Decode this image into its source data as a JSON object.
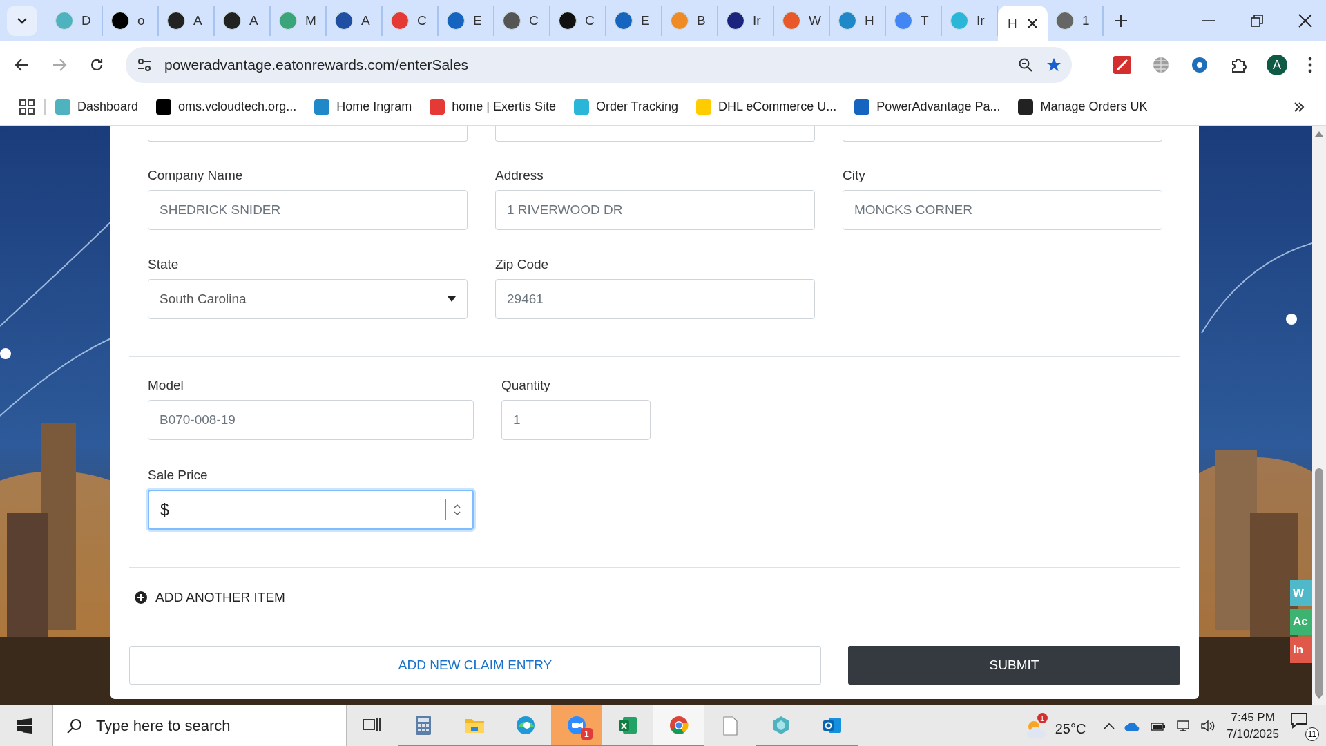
{
  "browser": {
    "tabs": [
      {
        "title": "D",
        "color": "#4fb3bf",
        "selected": false
      },
      {
        "title": "o",
        "color": "#000000",
        "selected": false
      },
      {
        "title": "A",
        "color": "#222222",
        "selected": false
      },
      {
        "title": "A",
        "color": "#222222",
        "selected": false
      },
      {
        "title": "M",
        "color": "#3aa57a",
        "selected": false
      },
      {
        "title": "A",
        "color": "#1f4fa3",
        "selected": false
      },
      {
        "title": "C",
        "color": "#e53935",
        "selected": false
      },
      {
        "title": "E",
        "color": "#1565c0",
        "selected": false
      },
      {
        "title": "C",
        "color": "#555555",
        "selected": false
      },
      {
        "title": "C",
        "color": "#111111",
        "selected": false
      },
      {
        "title": "E",
        "color": "#1565c0",
        "selected": false
      },
      {
        "title": "B",
        "color": "#f08a24",
        "selected": false
      },
      {
        "title": "Ir",
        "color": "#1a237e",
        "selected": false
      },
      {
        "title": "W",
        "color": "#e8582b",
        "selected": false
      },
      {
        "title": "H",
        "color": "#1e88c8",
        "selected": false
      },
      {
        "title": "T",
        "color": "#4285f4",
        "selected": false
      },
      {
        "title": "Ir",
        "color": "#29b6d8",
        "selected": false
      },
      {
        "title": "H",
        "selected": true
      },
      {
        "title": "1",
        "color": "#666666",
        "selected": false
      }
    ],
    "url": "poweradvantage.eatonrewards.com/enterSales",
    "avatar": "A",
    "bookmarks": [
      {
        "label": "Dashboard",
        "color": "#4fb3bf"
      },
      {
        "label": "oms.vcloudtech.org...",
        "color": "#000000"
      },
      {
        "label": "Home Ingram",
        "color": "#1e88c8"
      },
      {
        "label": "home | Exertis Site",
        "color": "#e53935"
      },
      {
        "label": "Order Tracking",
        "color": "#29b6d8"
      },
      {
        "label": "DHL eCommerce U...",
        "color": "#ffcc00"
      },
      {
        "label": "PowerAdvantage Pa...",
        "color": "#1565c0"
      },
      {
        "label": "Manage Orders UK",
        "color": "#222222"
      }
    ]
  },
  "form": {
    "address_fields": [
      {
        "label": "Company Name",
        "value": "SHEDRICK SNIDER",
        "kind": "text"
      },
      {
        "label": "Address",
        "value": "1 RIVERWOOD DR",
        "kind": "text"
      },
      {
        "label": "City",
        "value": "MONCKS CORNER",
        "kind": "text"
      },
      {
        "label": "State",
        "value": "South Carolina",
        "kind": "select"
      },
      {
        "label": "Zip Code",
        "value": "29461",
        "kind": "text"
      }
    ],
    "item_fields": [
      {
        "label": "Model",
        "value": "B070-008-19",
        "kind": "text"
      },
      {
        "label": "Quantity",
        "value": "1",
        "kind": "text"
      },
      {
        "label": "Sale Price",
        "prefix": "$",
        "kind": "number",
        "focused": true
      }
    ],
    "add_item": "ADD ANOTHER ITEM",
    "secondary_button": "ADD NEW CLAIM ENTRY",
    "submit_button": "SUBMIT"
  },
  "side_tabs": [
    {
      "label": "W",
      "color": "#4fb8c9"
    },
    {
      "label": "Ac",
      "color": "#3cb371"
    },
    {
      "label": "In",
      "color": "#e0584a"
    }
  ],
  "taskbar": {
    "search_placeholder": "Type here to search",
    "apps": [
      {
        "kind": "taskview",
        "open": false,
        "focused": false,
        "flashing": false
      },
      {
        "kind": "calculator",
        "open": true,
        "focused": false,
        "flashing": false
      },
      {
        "kind": "folder",
        "open": true,
        "focused": false,
        "flashing": false
      },
      {
        "kind": "edge",
        "open": true,
        "focused": false,
        "flashing": false
      },
      {
        "kind": "zoom",
        "open": true,
        "focused": false,
        "flashing": true,
        "badge": "1"
      },
      {
        "kind": "excel",
        "open": true,
        "focused": false,
        "flashing": false
      },
      {
        "kind": "chrome",
        "open": true,
        "focused": true,
        "flashing": false
      },
      {
        "kind": "document",
        "open": false,
        "focused": false,
        "flashing": false
      },
      {
        "kind": "gem",
        "open": true,
        "focused": false,
        "flashing": false
      },
      {
        "kind": "outlook",
        "open": true,
        "focused": false,
        "flashing": false
      }
    ],
    "weather_badge": "1",
    "temperature": "25°C",
    "time": "7:45 PM",
    "date": "7/10/2025",
    "notifications": "11"
  }
}
